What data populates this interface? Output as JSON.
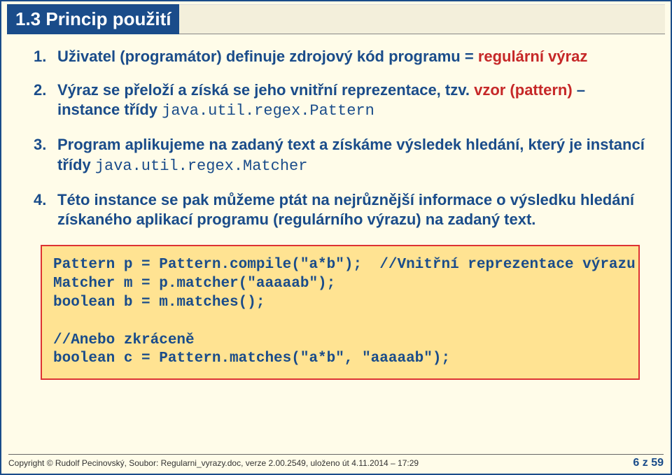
{
  "heading": "1.3  Princip použití",
  "list": {
    "item1_a": "Uživatel (programátor) definuje zdrojový kód programu = ",
    "item1_b": "regulární výraz",
    "item2_a": "Výraz se přeloží a získá se jeho vnitřní reprezentace, tzv. ",
    "item2_b": "vzor (pattern)",
    "item2_c": " – instance třídy ",
    "item2_d": "java.util.regex.Pattern",
    "item3_a": "Program aplikujeme na zadaný text a získáme výsledek hledání, který je instancí třídy ",
    "item3_b": "java.util.regex.Matcher",
    "item4": "Této instance se pak můžeme ptát na nejrůznější informace o výsledku hledání získaného aplikací programu (regulárního výrazu) na zadaný text."
  },
  "code": "Pattern p = Pattern.compile(\"a*b\");  //Vnitřní reprezentace výrazu\nMatcher m = p.matcher(\"aaaaab\");\nboolean b = m.matches();\n\n//Anebo zkráceně\nboolean c = Pattern.matches(\"a*b\", \"aaaaab\");",
  "footer": {
    "copyright": "Copyright © Rudolf Pecinovský, Soubor: Regularni_vyrazy.doc, verze 2.00.2549, uloženo út 4.11.2014 – 17:29",
    "page": "6 z 59"
  }
}
